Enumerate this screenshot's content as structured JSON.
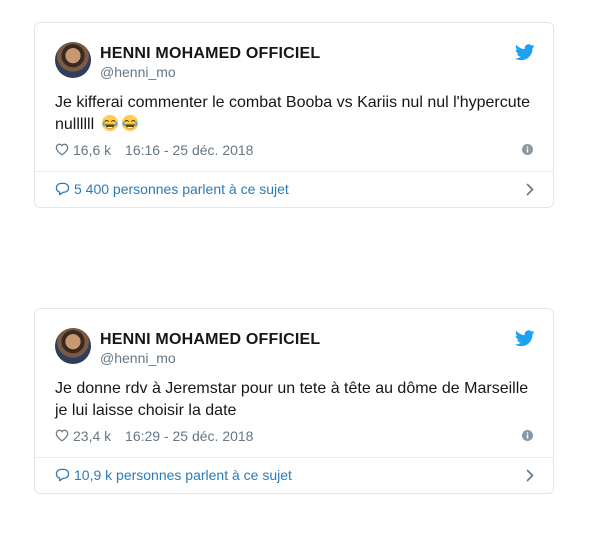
{
  "tweets": [
    {
      "display_name": "HENNI MOHAMED OFFICIEL",
      "handle": "@henni_mo",
      "text": "Je kifferai commenter le combat Booba vs Kariis nul nul l'hypercute nullllll",
      "emojis": [
        "tears-of-joy",
        "tears-of-joy"
      ],
      "likes": "16,6 k",
      "timestamp": "16:16 - 25 déc. 2018",
      "conversation": "5 400 personnes parlent à ce sujet"
    },
    {
      "display_name": "HENNI MOHAMED OFFICIEL",
      "handle": "@henni_mo",
      "text": "Je donne rdv à Jeremstar pour un tete à tête au dôme de Marseille je lui laisse choisir la date",
      "emojis": [],
      "likes": "23,4 k",
      "timestamp": "16:29 - 25 déc. 2018",
      "conversation": "10,9 k personnes parlent à ce sujet"
    }
  ],
  "colors": {
    "accent": "#1da1f2",
    "link": "#2b7bb9",
    "muted": "#657786",
    "border": "#e1e8ed"
  },
  "icons": [
    "twitter-bird-icon",
    "heart-icon",
    "info-icon",
    "speech-bubble-icon",
    "chevron-right-icon",
    "tears-of-joy-emoji"
  ]
}
